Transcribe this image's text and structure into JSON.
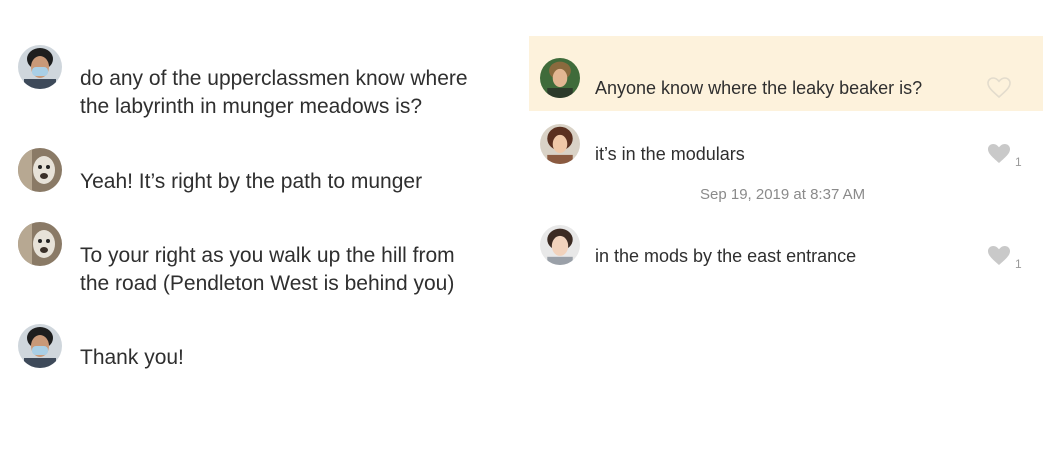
{
  "left_thread": {
    "messages": [
      {
        "line1": "do any of the upperclassmen know where",
        "line2": "the labyrinth in munger meadows is?",
        "avatar": "avatar-masked-girl"
      },
      {
        "line1": "Yeah! It’s right by the path to munger",
        "line2": "",
        "avatar": "avatar-dog"
      },
      {
        "line1": "To your right as you walk up the hill from",
        "line2": "the road (Pendleton West is behind you)",
        "avatar": "avatar-dog"
      },
      {
        "line1": "Thank you!",
        "line2": "",
        "avatar": "avatar-masked-girl"
      }
    ]
  },
  "right_thread": {
    "question": {
      "text": "Anyone know where the leaky beaker is?",
      "likes": ""
    },
    "replies": [
      {
        "text": "it’s in the modulars",
        "likes": "1"
      },
      {
        "text": "in the mods by the east entrance",
        "likes": "1"
      }
    ],
    "timestamp": "Sep 19, 2019 at 8:37 AM"
  },
  "colors": {
    "highlight": "#fdf2dc",
    "heart_outline": "#e3dccd",
    "heart_filled": "#c9c9c9"
  },
  "icons": [
    "heart-outline-icon",
    "heart-filled-icon"
  ]
}
